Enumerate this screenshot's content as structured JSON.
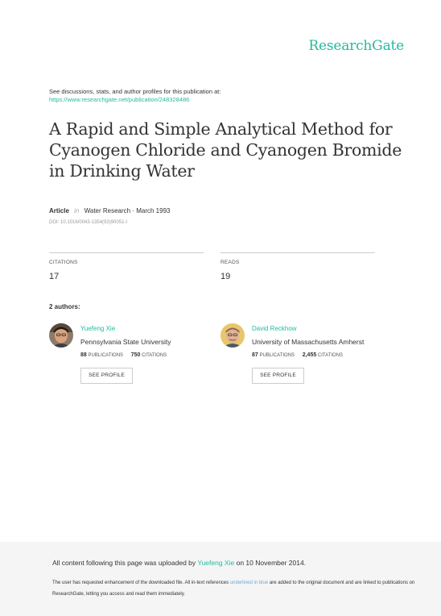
{
  "header": {
    "logo": "ResearchGate",
    "intro_line": "See discussions, stats, and author profiles for this publication at:",
    "url": "https://www.researchgate.net/publication/248328486"
  },
  "publication": {
    "title": "A Rapid and Simple Analytical Method for Cyanogen Chloride and Cyanogen Bromide in Drinking Water",
    "type": "Article",
    "in_word": "in",
    "journal_date": "Water Research · March 1993",
    "doi": "DOI: 10.1016/0043-1354(93)90051-I"
  },
  "stats": {
    "citations_label": "CITATIONS",
    "citations_value": "17",
    "reads_label": "READS",
    "reads_value": "19"
  },
  "authors_heading": "2 authors:",
  "authors": [
    {
      "name": "Yuefeng Xie",
      "institution": "Pennsylvania State University",
      "publications_count": "88",
      "publications_label": "PUBLICATIONS",
      "citations_count": "750",
      "citations_label": "CITATIONS",
      "button": "SEE PROFILE"
    },
    {
      "name": "David Reckhow",
      "institution": "University of Massachusetts Amherst",
      "publications_count": "87",
      "publications_label": "PUBLICATIONS",
      "citations_count": "2,455",
      "citations_label": "CITATIONS",
      "button": "SEE PROFILE"
    }
  ],
  "footer": {
    "uploaded_prefix": "All content following this page was uploaded by",
    "uploaded_by": "Yuefeng Xie",
    "uploaded_suffix": "on 10 November 2014.",
    "note_part1": "The user has requested enhancement of the downloaded file. All in-text references",
    "note_underlined": "underlined in blue",
    "note_part2": "are added to the original document and are linked to publications on ResearchGate, letting you access and read them immediately."
  },
  "colors": {
    "brand": "#25ba9e",
    "link_blue": "#6aa9d9",
    "footer_bg": "#f5f5f5"
  }
}
